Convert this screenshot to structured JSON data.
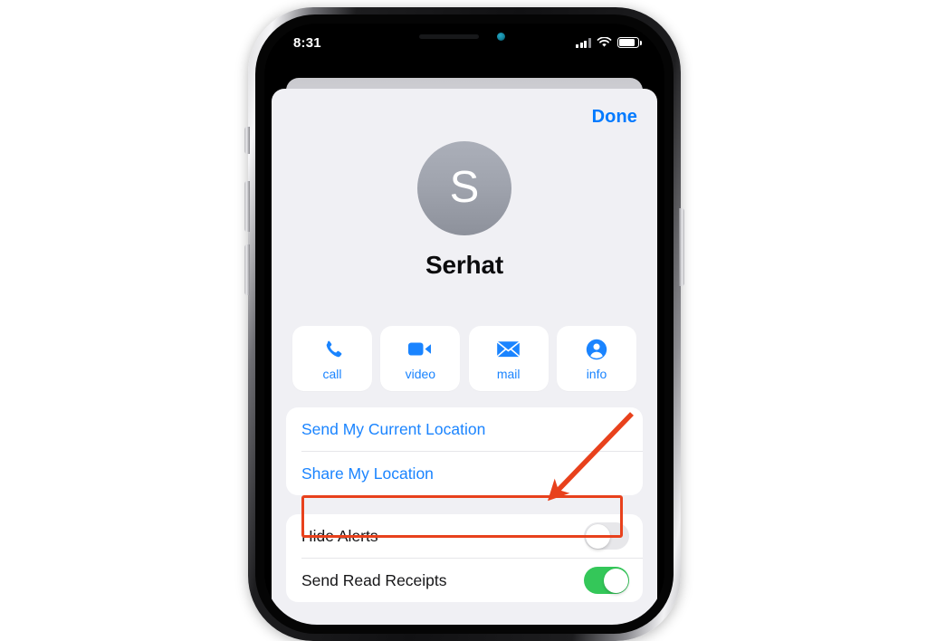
{
  "status_bar": {
    "time": "8:31",
    "signal_icon": "cellular-bars-icon",
    "wifi_icon": "wifi-icon",
    "battery_icon": "battery-icon"
  },
  "sheet": {
    "done_label": "Done"
  },
  "contact": {
    "initial": "S",
    "name": "Serhat",
    "avatar_color_top": "#abafb9",
    "avatar_color_bottom": "#8d919b"
  },
  "actions": [
    {
      "label": "call",
      "icon": "phone-icon"
    },
    {
      "label": "video",
      "icon": "video-camera-icon"
    },
    {
      "label": "mail",
      "icon": "envelope-icon"
    },
    {
      "label": "info",
      "icon": "person-circle-icon"
    }
  ],
  "location_rows": [
    {
      "label": "Send My Current Location"
    },
    {
      "label": "Share My Location"
    }
  ],
  "settings_rows": [
    {
      "label": "Hide Alerts",
      "toggle_state": "off"
    },
    {
      "label": "Send Read Receipts",
      "toggle_state": "on"
    }
  ],
  "annotation": {
    "highlight_target": "Hide Alerts",
    "color": "#e8411c",
    "arrow_name": "red-arrow-annotation"
  },
  "theme": {
    "accent_blue": "#007aff",
    "link_blue": "#1a84ff",
    "toggle_on_green": "#34c759",
    "toggle_off_gray": "#e7e7ea",
    "sheet_background": "#f0f0f4",
    "card_background": "#ffffff"
  }
}
